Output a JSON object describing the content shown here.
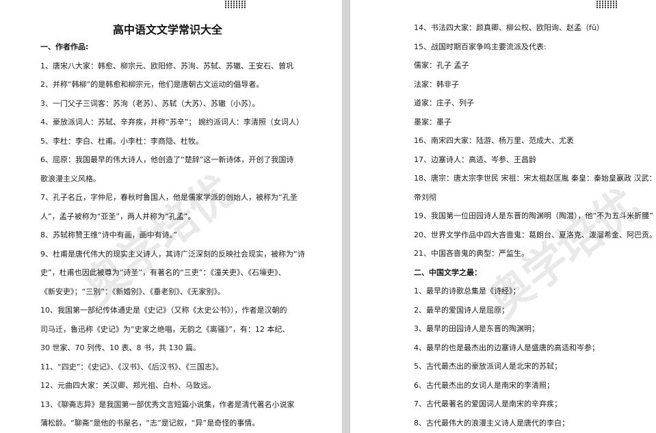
{
  "left_page": {
    "title": "高中语文文学常识大全",
    "lines": [
      "一、作者作品:",
      "1、唐宋八大家：韩愈、柳宗元、欧阳修、苏洵、苏轼、苏辙、王安石、曾巩",
      "2、并称“韩柳”的是韩愈和柳宗元，他们是唐朝古文运动的倡导者。",
      "3、一门父子三词客：苏洵（老苏）、苏轼（大苏）、苏辙（小苏）。",
      "4、豪放派词人：苏轼、辛弃疾，并称“苏辛”；  婉约派词人：李清照（女词人）",
      "5、李杜：李白、杜甫。小李杜：李商隐、杜牧。",
      "6、屈原：我国最早的伟大诗人，他创造了“楚辞”这一新诗体，开创了我国诗",
      "歌浪漫主义风格。",
      "7、孔子名丘，字仲尼，春秋时鲁国人，他是儒家学派的创始人，被称为“孔圣",
      "人”，孟子被称为“亚圣”，两人并称为“孔孟”。",
      "8、苏轼称赞王维“诗中有画，画中有诗。”",
      "9、杜甫是唐代伟大的现实主义诗人，其诗广泛深刻的反映社会现实，被称为“诗",
      "史”，杜甫也因此被尊为“诗圣”，有著名的“三吏”：《潼关吏》、《石壕吏》、",
      "《新安吏》；“三别”：《新婚别》、《垂老别》、《无家别》。",
      "10、我国第一部纪传体通史是《史记》（又称《太史公书》），作者是汉朝的",
      "司马迁，鲁迅称《史记》为“史家之绝唱，无韵之《离骚》”，有：12 本纪、",
      "30 世家、70 列传、10 表、8 书，共 130 篇。",
      "11、“四史”：《史记》、《汉书》、《后汉书》、《三国志》。",
      "12、元曲四大家：关汉卿、郑光祖、白朴、马致远。",
      "13、《聊斋志异》是我国第一部优秀文言短篇小说集，作者是清代著名小说家",
      "蒲松龄。“聊斋”是他的书屋名，“志”是记叙，“异”是奇怪的事情。"
    ]
  },
  "right_page": {
    "lines": [
      "14、书法四大家：颜真卿、柳公权、欧阳询、赵孟（fǔ）",
      "15、战国时期百家争鸣主要流派及代表:",
      "儒家：孔子 孟子",
      "法家：韩非子",
      "道家：庄子、列子",
      "墨家：墨子",
      "16、南宋四大家：陆游、杨万里、范成大、尤袤",
      "17、边塞诗人：高适、岑参、王昌龄",
      "18、唐宗：唐太宗李世民 宋祖：宋太祖赵匡胤 秦皇：秦始皇嬴政 汉武：汉武",
      "帝刘彻",
      "19、我国第一位田园诗人是东晋的陶渊明（陶潜），他“不为五斗米折腰”",
      "20、世界文学作品中四大吝啬鬼：葛朗台、夏洛克、泼溜希金、阿巴贡。",
      "21、中国吝啬鬼的典型：严监生。",
      "二、中国文学之最：",
      "1、最早的诗歌总集是《诗经》；",
      "2、最早的爱国诗人是屈原；",
      "3、最早的田园诗人是东晋的陶渊明；",
      "4、最早的也是最杰出的边塞诗人是盛唐的高适和岑参；",
      "5、古代最杰出的豪放派词人是北宋的苏轼；",
      "6、古代最杰出的女词人是南宋的李清照；",
      "7、古代最著名的爱国词人是南宋的辛弃疾；",
      "8、古代最伟大的浪漫主义诗人是唐代的李白；"
    ]
  },
  "watermark_text": "奥学培优"
}
